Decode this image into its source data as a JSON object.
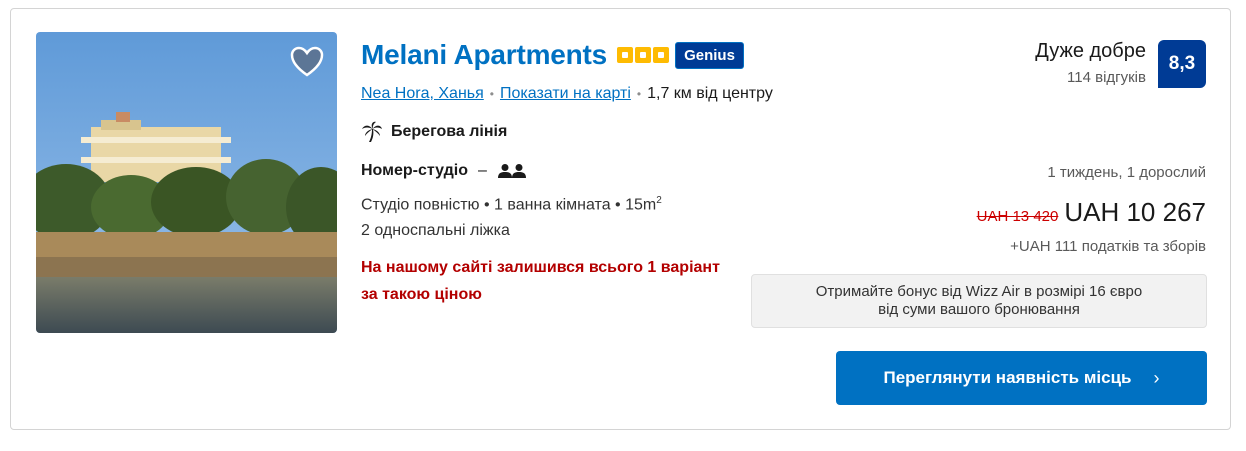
{
  "property": {
    "name": "Melani Apartments",
    "stars": 3,
    "genius_label": "Genius",
    "location": {
      "area": "Nea Hora, Ханья",
      "map_link": "Показати на карті",
      "distance": "1,7 км від центру"
    },
    "feature": "Берегова лінія"
  },
  "room": {
    "name": "Номер-студіо",
    "dash": "–",
    "details_main": "Студіо повністю • 1 ванна кімната • 15m",
    "details_sup": "2",
    "beds": "2 односпальні ліжка",
    "urgency": "На нашому сайті залишився всього 1 варіант за такою ціною"
  },
  "review": {
    "word": "Дуже добре",
    "count": "114 відгуків",
    "score": "8,3"
  },
  "price": {
    "stay": "1 тиждень, 1 дорослий",
    "old": "UAH 13 420",
    "current": "UAH 10 267",
    "taxes": "+UAH 111 податків та зборів"
  },
  "bonus": {
    "line1": "Отримайте бонус від Wizz Air в розмірі 16 євро",
    "line2": "від суми вашого бронювання"
  },
  "cta": {
    "label": "Переглянути наявність місць",
    "chevron": "›"
  },
  "colors": {
    "link": "#0071c2",
    "score_bg": "#003b95",
    "star": "#febb02",
    "urgency": "#b30000"
  },
  "icons": {
    "favorite": "heart-icon",
    "feature": "palm-tree-icon",
    "occupancy": "two-persons-icon",
    "chevron": "chevron-right-icon"
  }
}
